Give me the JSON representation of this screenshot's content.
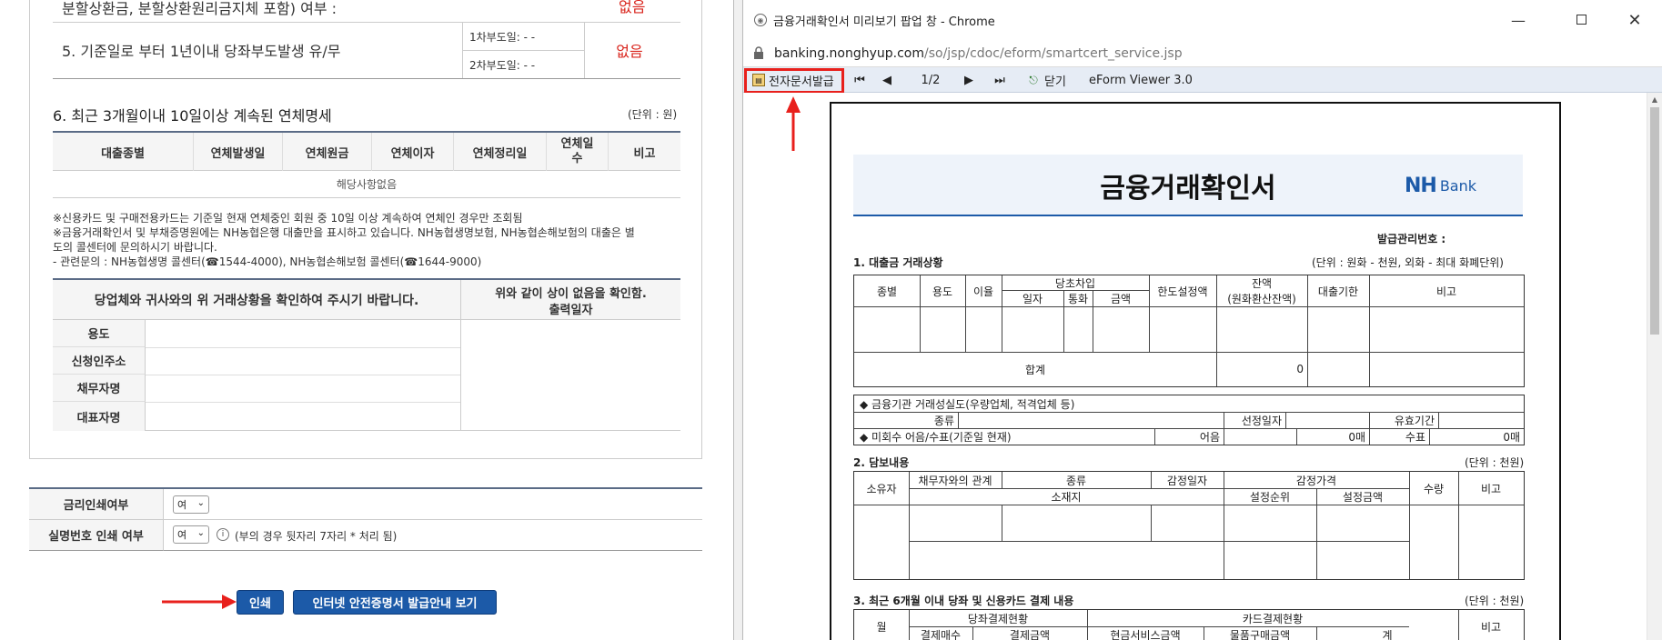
{
  "left": {
    "item4_text": "분할상환금, 분할상환원리금지체 포함) 여부 :",
    "item4_value": "없음",
    "item5_text": "5. 기준일로 부터 1년이내 당좌부도발생 유/무",
    "item5_line1": "1차부도일: - -",
    "item5_line2": "2차부도일: - -",
    "item5_value": "없음",
    "section6_title": "6. 최근 3개월이내 10일이상 계속된 연체명세",
    "section6_unit": "(단위 : 원)",
    "table6_headers": [
      "대출종별",
      "연체발생일",
      "연체원금",
      "연체이자",
      "연체정리일",
      "연체일수",
      "비고"
    ],
    "table6_empty": "해당사항없음",
    "notes": [
      "※신용카드 및 구매전용카드는 기준일 현재 연체중인 회원 중 10일 이상 계속하여 연체인 경우만 조회됨",
      "※금융거래확인서 및 부채증명원에는 NH농협은행 대출만을 표시하고 있습니다. NH농협생명보험, NH농협손해보험의 대출은 별",
      "도의 콜센터에 문의하시기 바랍니다.",
      "- 관련문의 : NH농협생명 콜센터(☎1544-4000), NH농협손해보험 콜센터(☎1644-9000)"
    ],
    "confirm_text": "당업체와 귀사와의 위 거래상황을 확인하여 주시기 바랍니다.",
    "confirm_right1": "위와 같이 상이 없음을 확인함.",
    "confirm_right2": "출력일자",
    "confirm_rows": [
      "용도",
      "신청인주소",
      "채무자명",
      "대표자명"
    ],
    "opt1_label": "금리인쇄여부",
    "opt1_value": "여",
    "opt2_label": "실명번호 인쇄 여부",
    "opt2_value": "여",
    "opt2_note": "(부의 경우 뒷자리 7자리 * 처리 됨)",
    "print_button": "인쇄",
    "guide_button": "인터넷 안전증명서 발급안내 보기",
    "colors": {
      "red": "#d9251d",
      "blue": "#1c5aa8",
      "arrow": "#e8201c"
    }
  },
  "popup": {
    "title": "금융거래확인서 미리보기 팝업 창 - Chrome",
    "url_domain": "banking.nonghyup.com",
    "url_path": "/so/jsp/cdoc/eform/smartcert_service.jsp",
    "toolbar": {
      "issue_button": "전자문서발급",
      "page": "1/2",
      "close_button": "닫기",
      "viewer_name": "eForm Viewer 3.0"
    },
    "doc": {
      "title": "금융거래확인서",
      "logo_nh": "NH",
      "logo_bank": "Bank",
      "issue_no_label": "발급관리번호 :",
      "s1_title": "1. 대출금 거래상황",
      "s1_unit": "(단위 : 원화 - 천원, 외화 - 최대 화폐단위)",
      "s1_headers": [
        "종별",
        "용도",
        "이율",
        "당초차입",
        "일자",
        "통화",
        "금액",
        "한도설정액",
        "잔액",
        "(원화환산잔액)",
        "대출기한",
        "비고"
      ],
      "s1_total_label": "합계",
      "s1_total_value": "0",
      "s1b_row1": "◆ 금융기관 거래성실도(우량업체, 적격업체 등)",
      "s1b_kind": "종류",
      "s1b_date": "선정일자",
      "s1b_valid": "유효기간",
      "s1b_row3": "◆ 미회수 어음/수표(기준일 현재)",
      "s1b_bill": "어음",
      "s1b_bill_value": "0매",
      "s1b_check": "수표",
      "s1b_check_value": "0매",
      "s2_title": "2. 담보내용",
      "s2_unit": "(단위 : 천원)",
      "s2_headers": [
        "소유자",
        "채무자와의 관계",
        "종류",
        "감정일자",
        "감정가격",
        "수량",
        "비고",
        "소재지",
        "설정순위",
        "설정금액"
      ],
      "s3_title": "3. 최근 6개월 이내 당좌 및 신용카드 결제 내용",
      "s3_unit": "(단위 : 천원)",
      "s3_headers": [
        "월",
        "당좌결제현황",
        "카드결제현황",
        "비고",
        "결제매수",
        "결제금액",
        "현금서비스금액",
        "물품구매금액",
        "계"
      ]
    }
  }
}
